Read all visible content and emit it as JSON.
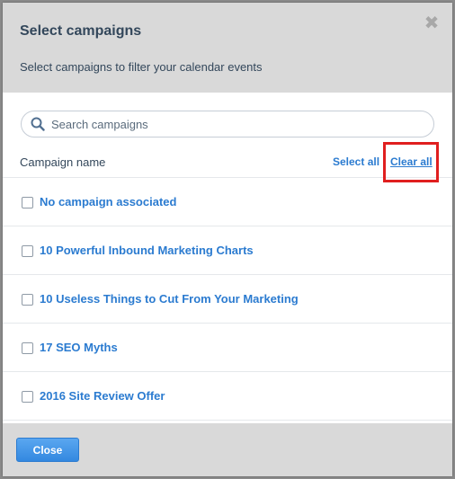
{
  "modal": {
    "title": "Select campaigns",
    "subtitle": "Select campaigns to filter your calendar events",
    "close_glyph": "✖"
  },
  "search": {
    "placeholder": "Search campaigns",
    "value": ""
  },
  "list_header": {
    "column_label": "Campaign name",
    "select_all": "Select all",
    "clear_all": "Clear all"
  },
  "campaigns": [
    {
      "label": "No campaign associated",
      "checked": false
    },
    {
      "label": "10 Powerful Inbound Marketing Charts",
      "checked": false
    },
    {
      "label": "10 Useless Things to Cut From Your Marketing",
      "checked": false
    },
    {
      "label": "17 SEO Myths",
      "checked": false
    },
    {
      "label": "2016 Site Review Offer",
      "checked": false
    }
  ],
  "footer": {
    "close_label": "Close"
  },
  "colors": {
    "link": "#2b7bd0",
    "header_bg": "#d9d9d9",
    "highlight": "#e01f1f",
    "button": "#3388e0"
  },
  "icons": {
    "search": "search-icon",
    "close": "close-icon"
  }
}
